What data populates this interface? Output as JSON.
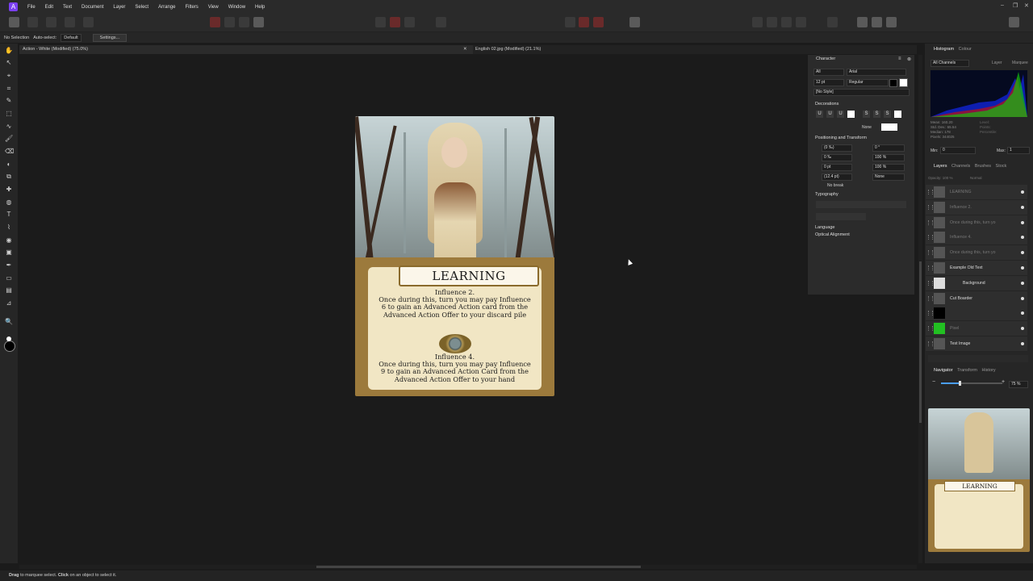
{
  "menu": [
    "File",
    "Edit",
    "Text",
    "Document",
    "Layer",
    "Select",
    "Arrange",
    "Filters",
    "View",
    "Window",
    "Help"
  ],
  "context": {
    "selection": "No Selection",
    "autoselect_label": "Auto-select:",
    "autoselect_value": "Default",
    "settings_label": "Settings..."
  },
  "tabs": [
    {
      "label": "Action - White (Modified) (75.0%)"
    },
    {
      "label": "English 02.jpg (Modified) (21.1%)"
    }
  ],
  "card": {
    "title": "LEARNING",
    "block1_heading": "Influence 2.",
    "block1_body": "Once during this, turn you may pay Influence 6 to gain an Advanced Action card from the Advanced Action Offer to your discard pile",
    "block2_heading": "Influence 4.",
    "block2_body": "Once during this, turn you may pay Influence 9 to gain an Advanced Action Card from the Advanced Action Offer to your hand"
  },
  "character": {
    "title": "Character",
    "scope": "All",
    "font": "Arial",
    "size": "12 pt",
    "weight": "Regular",
    "style": "[No Style]",
    "decorations_label": "Decorations",
    "decoration_none": "None",
    "positioning_label": "Positioning and Transform",
    "kerning": "(0 ‰)",
    "tracking": "0 ‰",
    "baseline": "0 pt",
    "leading": "(12.4 pt)",
    "angle": "0 °",
    "hscale": "100 %",
    "vscale": "100 %",
    "transform": "None",
    "no_break": "No break",
    "typography_label": "Typography",
    "language_label": "Language",
    "optical_label": "Optical Alignment"
  },
  "histogram": {
    "tab1": "Histogram",
    "tab2": "Colour",
    "channels": "All Channels",
    "layer_label": "Layer",
    "marquee_label": "Marquee",
    "mean": "Mean: 160.20",
    "std": "Std. Dev.: 65.54",
    "median": "Median: 178",
    "pixels": "Pixels: 344025",
    "level": "Level:",
    "points": "Points:",
    "percentile": "Percentile:",
    "min_label": "Min:",
    "min_val": "0",
    "max_label": "Max:",
    "max_val": "1"
  },
  "layers_tabs": [
    "Layers",
    "Channels",
    "Brushes",
    "Stock"
  ],
  "layers_opts": {
    "opacity": "Opacity: 100 %",
    "blend": "Normal"
  },
  "layers": [
    {
      "name": "LEARNING",
      "dim": true
    },
    {
      "name": "Influence 2.",
      "dim": true
    },
    {
      "name": "Once during this, turn yo",
      "dim": true
    },
    {
      "name": "Influence 4.",
      "dim": true
    },
    {
      "name": "Once during this, turn yo",
      "dim": true
    },
    {
      "name": "Example Old Text",
      "dim": false
    },
    {
      "name": "Background",
      "dim": false
    },
    {
      "name": "Cut Boarder",
      "dim": false
    },
    {
      "name": "",
      "dim": false
    },
    {
      "name": "Pixel",
      "dim": true
    },
    {
      "name": "Test Image",
      "dim": false
    }
  ],
  "navigator": {
    "tabs": [
      "Navigator",
      "Transform",
      "History"
    ],
    "zoom": "75 %"
  },
  "status": {
    "drag": "Drag",
    "drag_text": "to marquee select.",
    "click": "Click",
    "click_text": "on an object to select it."
  }
}
